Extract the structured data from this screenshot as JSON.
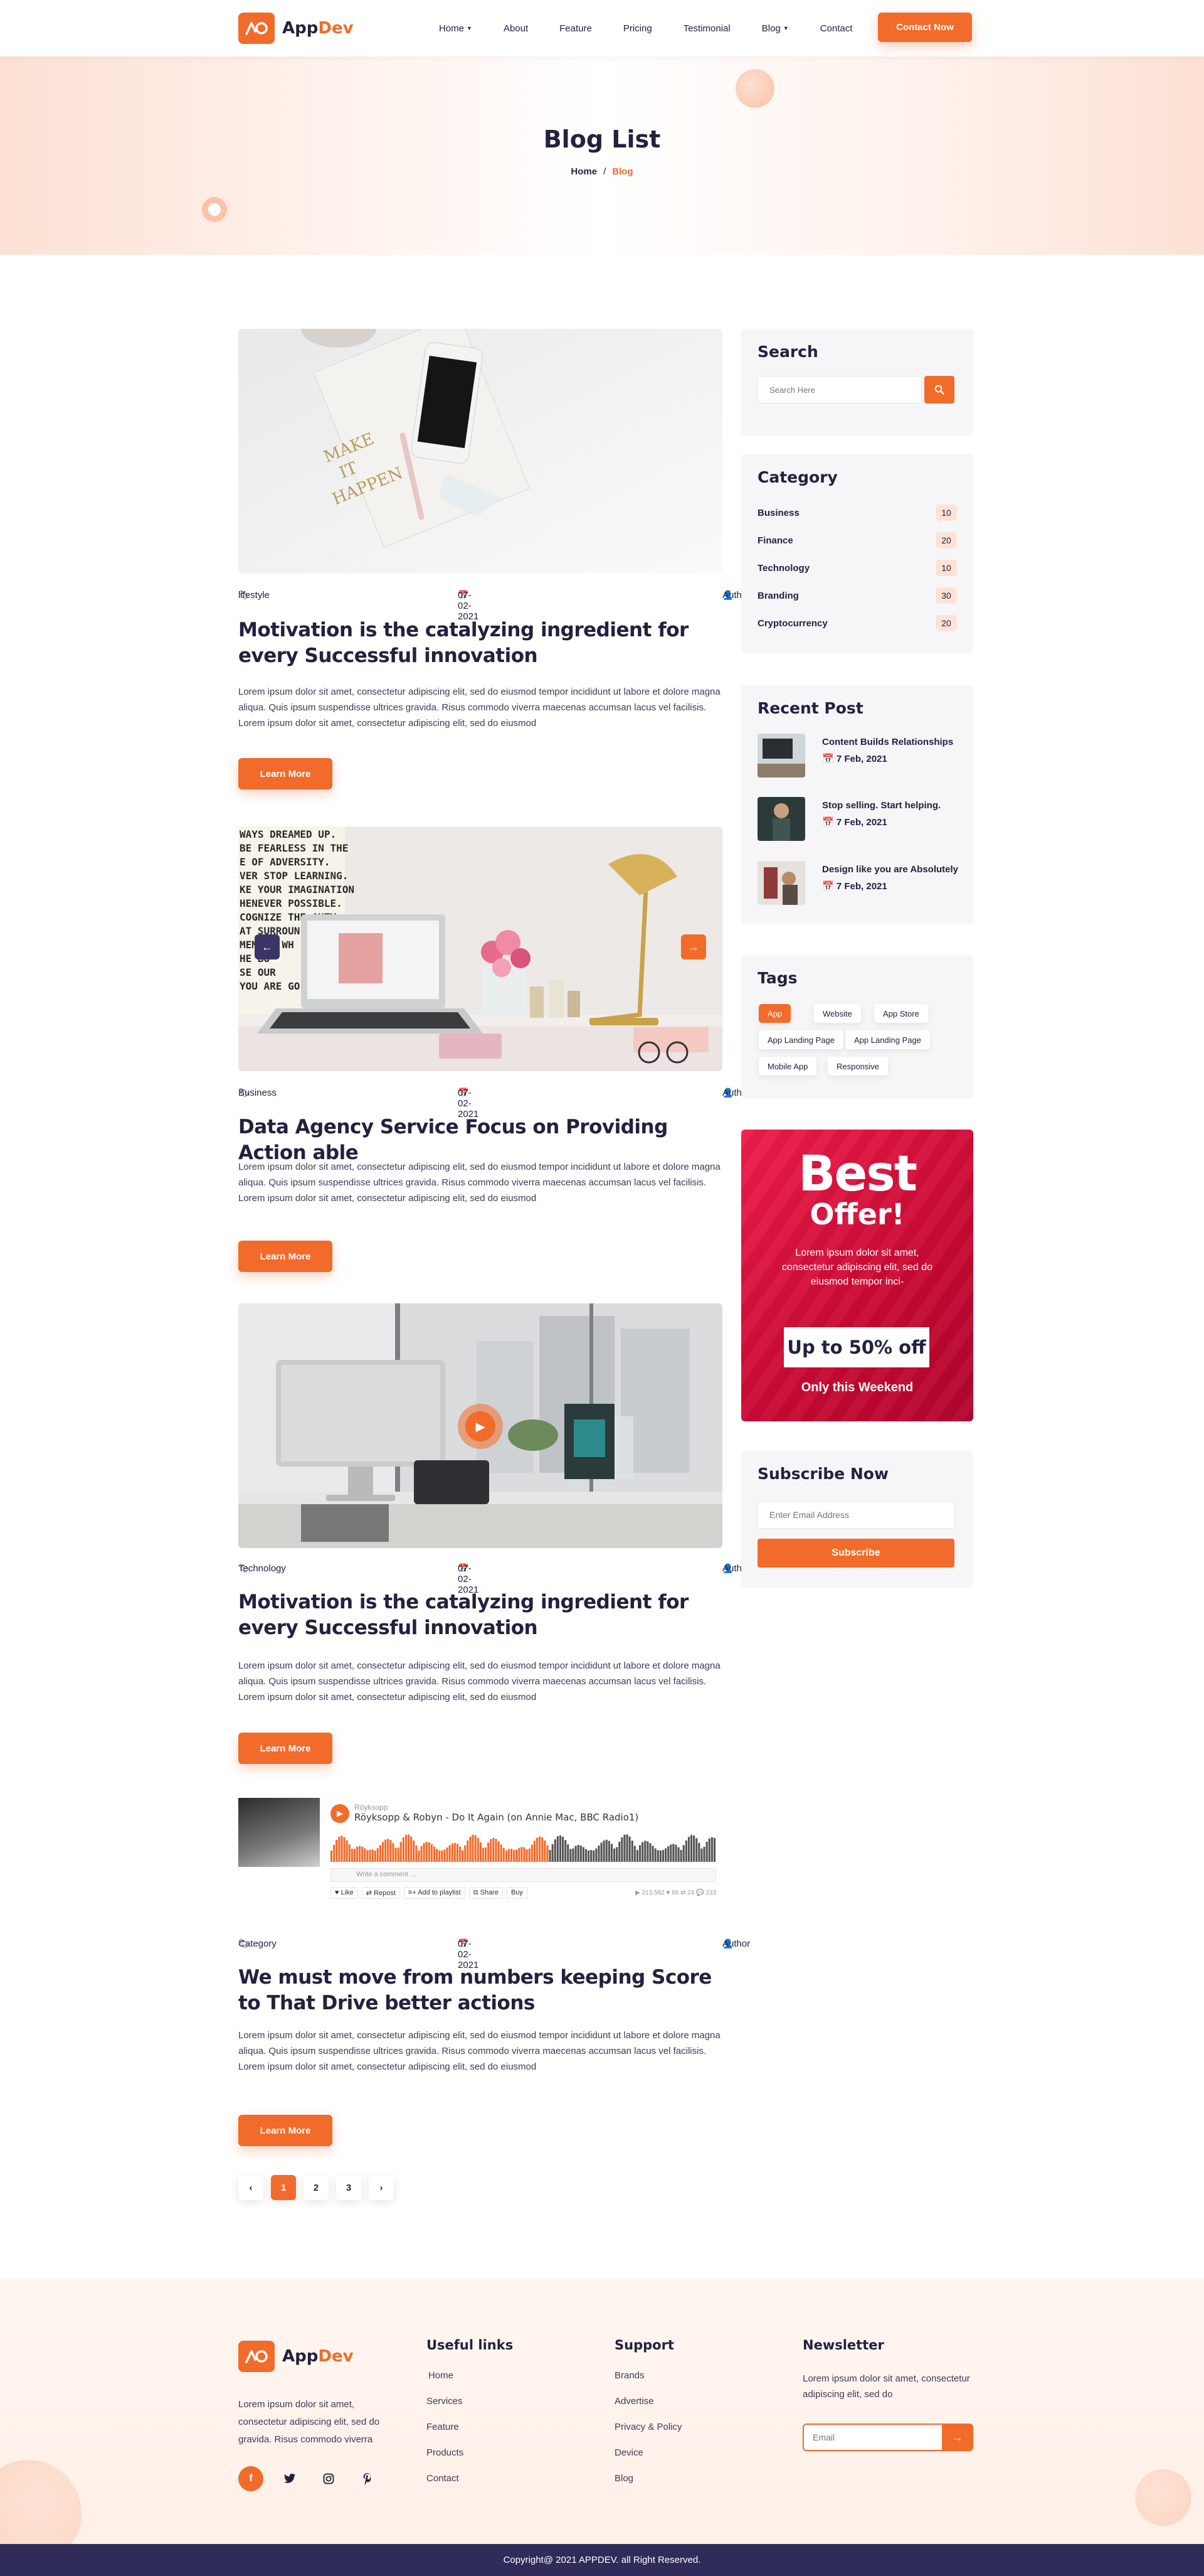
{
  "brand": {
    "name_part1": "App",
    "name_part2": "Dev",
    "color": "#f26b2a"
  },
  "nav": {
    "items": [
      {
        "label": "Home",
        "dropdown": true
      },
      {
        "label": "About",
        "dropdown": false
      },
      {
        "label": "Feature",
        "dropdown": false
      },
      {
        "label": "Pricing",
        "dropdown": false
      },
      {
        "label": "Testimonial",
        "dropdown": false
      },
      {
        "label": "Blog",
        "dropdown": true
      },
      {
        "label": "Contact",
        "dropdown": false
      }
    ],
    "cta_label": "Contact Now"
  },
  "hero": {
    "title": "Blog List",
    "breadcrumb_home": "Home",
    "breadcrumb_sep": "/",
    "breadcrumb_current": "Blog"
  },
  "posts": [
    {
      "category": "lifestyle",
      "date": "07-02-2021",
      "author": "Author",
      "title": "Motivation is the catalyzing ingredient for every Successful innovation",
      "excerpt": "Lorem ipsum dolor sit amet, consectetur adipiscing elit, sed do eiusmod tempor incididunt ut labore et dolore magna aliqua. Quis ipsum suspendisse ultrices gravida. Risus commodo viverra maecenas accumsan lacus vel facilisis. Lorem ipsum dolor sit amet, consectetur adipiscing elit, sed do eiusmod",
      "button": "Learn More",
      "image_text": [
        "MAKE",
        "IT",
        "HAPPEN"
      ]
    },
    {
      "category": "Business",
      "date": "07-02-2021",
      "author": "Author",
      "title": "Data Agency Service Focus on Providing  Action able",
      "excerpt": "Lorem ipsum dolor sit amet, consectetur adipiscing elit, sed do eiusmod tempor incididunt ut labore et dolore magna aliqua. Quis ipsum suspendisse ultrices gravida. Risus commodo viverra maecenas accumsan lacus vel facilisis. Lorem ipsum dolor sit amet, consectetur adipiscing elit, sed do eiusmod",
      "button": "Learn More",
      "image_text": [
        "WAYS DREAMED UP.",
        "BE FEARLESS IN THE",
        "E OF ADVERSITY.",
        "VER STOP LEARNING.",
        "KE YOUR IMAGINATION",
        "HENEVER POSSIBLE.",
        "COGNIZE THE   AUTY",
        "AT SURROUN",
        "MEMBER WH",
        "HE    BU",
        "SE    OUR",
        "YOU ARE GO"
      ]
    },
    {
      "category": "Technology",
      "date": "07-02-2021",
      "author": "Author",
      "title": "Motivation is the catalyzing ingredient for every Successful innovation",
      "excerpt": "Lorem ipsum dolor sit amet, consectetur adipiscing elit, sed do eiusmod tempor incididunt ut labore et dolore magna aliqua. Quis ipsum suspendisse ultrices gravida. Risus commodo viverra maecenas accumsan lacus vel facilisis. Lorem ipsum dolor sit amet, consectetur adipiscing elit, sed do eiusmod",
      "button": "Learn More"
    },
    {
      "category": "Category",
      "date": "07-02-2021",
      "author": "Author",
      "title": "We must move from numbers keeping Score to That  Drive better actions",
      "excerpt": "Lorem ipsum dolor sit amet, consectetur adipiscing elit, sed do eiusmod tempor incididunt ut labore et dolore magna aliqua. Quis ipsum suspendisse ultrices gravida. Risus commodo viverra maecenas accumsan lacus vel facilisis. Lorem ipsum dolor sit amet, consectetur adipiscing elit, sed do eiusmod",
      "button": "Learn More"
    }
  ],
  "audio": {
    "artist": "Röyksopp",
    "track": "Röyksopp & Robyn - Do It Again (on Annie Mac, BBC Radio1)",
    "comment_placeholder": "Write a comment ...",
    "actions": [
      "♥ Like",
      "⇄ Repost",
      "≡+ Add to playlist",
      "⧉ Share",
      "Buy"
    ],
    "stats": "▶ 213,582  ♥ 66  ⇄ 24  💬 233",
    "progress": 0.57
  },
  "pagination": {
    "prev": "‹",
    "pages": [
      "1",
      "2",
      "3"
    ],
    "active": "1",
    "next": "›"
  },
  "sidebar": {
    "search": {
      "title": "Search",
      "placeholder": "Search Here"
    },
    "category": {
      "title": "Category",
      "items": [
        {
          "name": "Business",
          "count": "10"
        },
        {
          "name": "Finance",
          "count": "20"
        },
        {
          "name": "Technology",
          "count": "10"
        },
        {
          "name": "Branding",
          "count": "30"
        },
        {
          "name": "Cryptocurrency",
          "count": "20"
        }
      ]
    },
    "recent": {
      "title": "Recent Post",
      "items": [
        {
          "title": "Content Builds Relationships",
          "date": "7 Feb, 2021"
        },
        {
          "title": "Stop selling. Start helping.",
          "date": "7 Feb, 2021"
        },
        {
          "title": "Design like you are Absolutely",
          "date": "7 Feb, 2021"
        }
      ]
    },
    "tags": {
      "title": "Tags",
      "items": [
        "App",
        "Website",
        "App Store",
        "App Landing Page",
        "App Landing Page",
        "Mobile App",
        "Responsive"
      ],
      "active": "App"
    },
    "offer": {
      "big": "Best",
      "sub": "Offer!",
      "text": "Lorem ipsum dolor sit amet, consectetur adipiscing elit, sed do eiusmod tempor inci-",
      "deal": "Up to 50% off",
      "note": "Only this Weekend"
    },
    "subscribe": {
      "title": "Subscribe Now",
      "placeholder": "Enter Email Address",
      "button": "Subscribe"
    }
  },
  "footer": {
    "about": "Lorem ipsum dolor sit amet, consectetur adipiscing elit, sed do gravida. Risus commodo viverra",
    "socials": [
      "facebook-icon",
      "twitter-icon",
      "instagram-icon",
      "pinterest-icon"
    ],
    "useful": {
      "title": "Useful links",
      "links": [
        "Home",
        "Services",
        "Feature",
        "Products",
        "Contact"
      ]
    },
    "support": {
      "title": "Support",
      "links": [
        "Brands",
        "Advertise",
        "Privacy & Policy",
        "Device",
        "Blog"
      ]
    },
    "newsletter": {
      "title": "Newsletter",
      "text": "Lorem ipsum dolor sit amet, consectetur adipiscing elit, sed do",
      "placeholder": "Email"
    },
    "copyright": "Copyright@ 2021 APPDEV. all Right Reserved."
  }
}
